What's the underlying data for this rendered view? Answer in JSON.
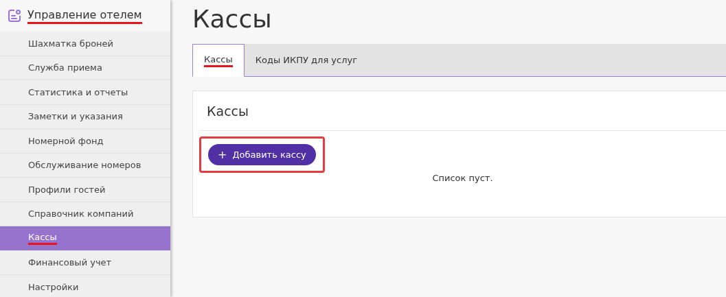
{
  "sidebar": {
    "header": {
      "label": "Управление отелем",
      "underlined": true
    },
    "items": [
      {
        "label": "Шахматка броней",
        "selected": false,
        "underlined": false
      },
      {
        "label": "Служба приема",
        "selected": false,
        "underlined": false
      },
      {
        "label": "Статистика и отчеты",
        "selected": false,
        "underlined": false
      },
      {
        "label": "Заметки и указания",
        "selected": false,
        "underlined": false
      },
      {
        "label": "Номерной фонд",
        "selected": false,
        "underlined": false
      },
      {
        "label": "Обслуживание номеров",
        "selected": false,
        "underlined": false
      },
      {
        "label": "Профили гостей",
        "selected": false,
        "underlined": false
      },
      {
        "label": "Справочник компаний",
        "selected": false,
        "underlined": false
      },
      {
        "label": "Кассы",
        "selected": true,
        "underlined": true
      },
      {
        "label": "Финансовый учет",
        "selected": false,
        "underlined": false
      },
      {
        "label": "Настройки",
        "selected": false,
        "underlined": false
      }
    ]
  },
  "page_title": "Кассы",
  "tabs": [
    {
      "label": "Кассы",
      "selected": true,
      "underlined": true
    },
    {
      "label": "Коды ИКПУ для услуг",
      "selected": false,
      "underlined": false
    }
  ],
  "panel": {
    "title": "Кассы",
    "add_button": {
      "label": "Добавить кассу",
      "icon": "+",
      "highlighted": true
    },
    "empty_text": "Список пуст."
  }
}
